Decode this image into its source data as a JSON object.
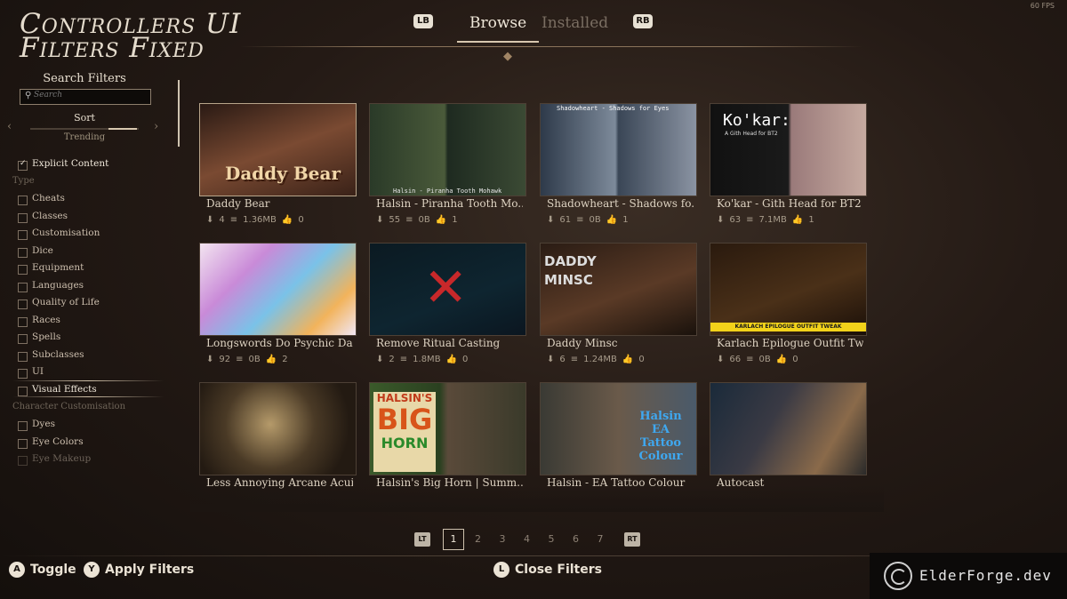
{
  "fps": "60 FPS",
  "logo": {
    "line1": "Controllers UI",
    "line2": "Filters Fixed"
  },
  "tabs": {
    "lb": "LB",
    "rb": "RB",
    "browse": "Browse",
    "installed": "Installed"
  },
  "sidebar": {
    "title": "Search Filters",
    "search_placeholder": "Search",
    "sort_label": "Sort",
    "sort_value": "Trending",
    "explicit": "Explicit Content",
    "type_section": "Type",
    "types": [
      "Cheats",
      "Classes",
      "Customisation",
      "Dice",
      "Equipment",
      "Languages",
      "Quality of Life",
      "Races",
      "Spells",
      "Subclasses",
      "UI",
      "Visual Effects"
    ],
    "char_section": "Character Customisation",
    "char_items": [
      "Dyes",
      "Eye Colors",
      "Eye Makeup"
    ]
  },
  "mods": [
    {
      "title": "Daddy Bear",
      "downloads": "4",
      "size": "1.36MB",
      "likes": "0",
      "overlay": "Daddy Bear"
    },
    {
      "title": "Halsin - Piranha Tooth Mo...",
      "downloads": "55",
      "size": "0B",
      "likes": "1",
      "overlay": "Halsin - Piranha Tooth Mohawk"
    },
    {
      "title": "Shadowheart - Shadows fo...",
      "downloads": "61",
      "size": "0B",
      "likes": "1",
      "overlay": "Shadowheart - Shadows for Eyes"
    },
    {
      "title": "Ko'kar - Gith Head for BT2",
      "downloads": "63",
      "size": "7.1MB",
      "likes": "1",
      "overlay": "Ko'kar:",
      "overlay2": "A Gith Head for BT2"
    },
    {
      "title": "Longswords Do Psychic Da...",
      "downloads": "92",
      "size": "0B",
      "likes": "2",
      "overlay": ""
    },
    {
      "title": "Remove Ritual Casting",
      "downloads": "2",
      "size": "1.8MB",
      "likes": "0",
      "overlay": ""
    },
    {
      "title": "Daddy Minsc",
      "downloads": "6",
      "size": "1.24MB",
      "likes": "0",
      "overlay": "DADDY MINSC"
    },
    {
      "title": "Karlach Epilogue Outfit Tw...",
      "downloads": "66",
      "size": "0B",
      "likes": "0",
      "overlay": "KARLACH EPILOGUE OUTFIT TWEAK"
    },
    {
      "title": "Less Annoying Arcane Acuity",
      "downloads": "",
      "size": "",
      "likes": "",
      "overlay": ""
    },
    {
      "title": "Halsin's Big Horn | Summ...",
      "downloads": "",
      "size": "",
      "likes": "",
      "overlay": "HALSIN'S",
      "overlay2": "BIG",
      "overlay3": "HORN"
    },
    {
      "title": "Halsin - EA Tattoo Colour",
      "downloads": "",
      "size": "",
      "likes": "",
      "overlay": "Halsin EA Tattoo Colour"
    },
    {
      "title": "Autocast",
      "downloads": "",
      "size": "",
      "likes": "",
      "overlay": ""
    }
  ],
  "pager": {
    "lt": "LT",
    "rt": "RT",
    "pages": [
      "1",
      "2",
      "3",
      "4",
      "5",
      "6",
      "7"
    ]
  },
  "hints": {
    "a_key": "A",
    "toggle": "Toggle",
    "y_key": "Y",
    "apply": "Apply Filters",
    "l_key": "L",
    "close": "Close Filters"
  },
  "watermark": "ElderForge.dev",
  "colors": {
    "accent": "#d8c8b0",
    "background": "#241a15",
    "text": "#d8cbb8"
  }
}
